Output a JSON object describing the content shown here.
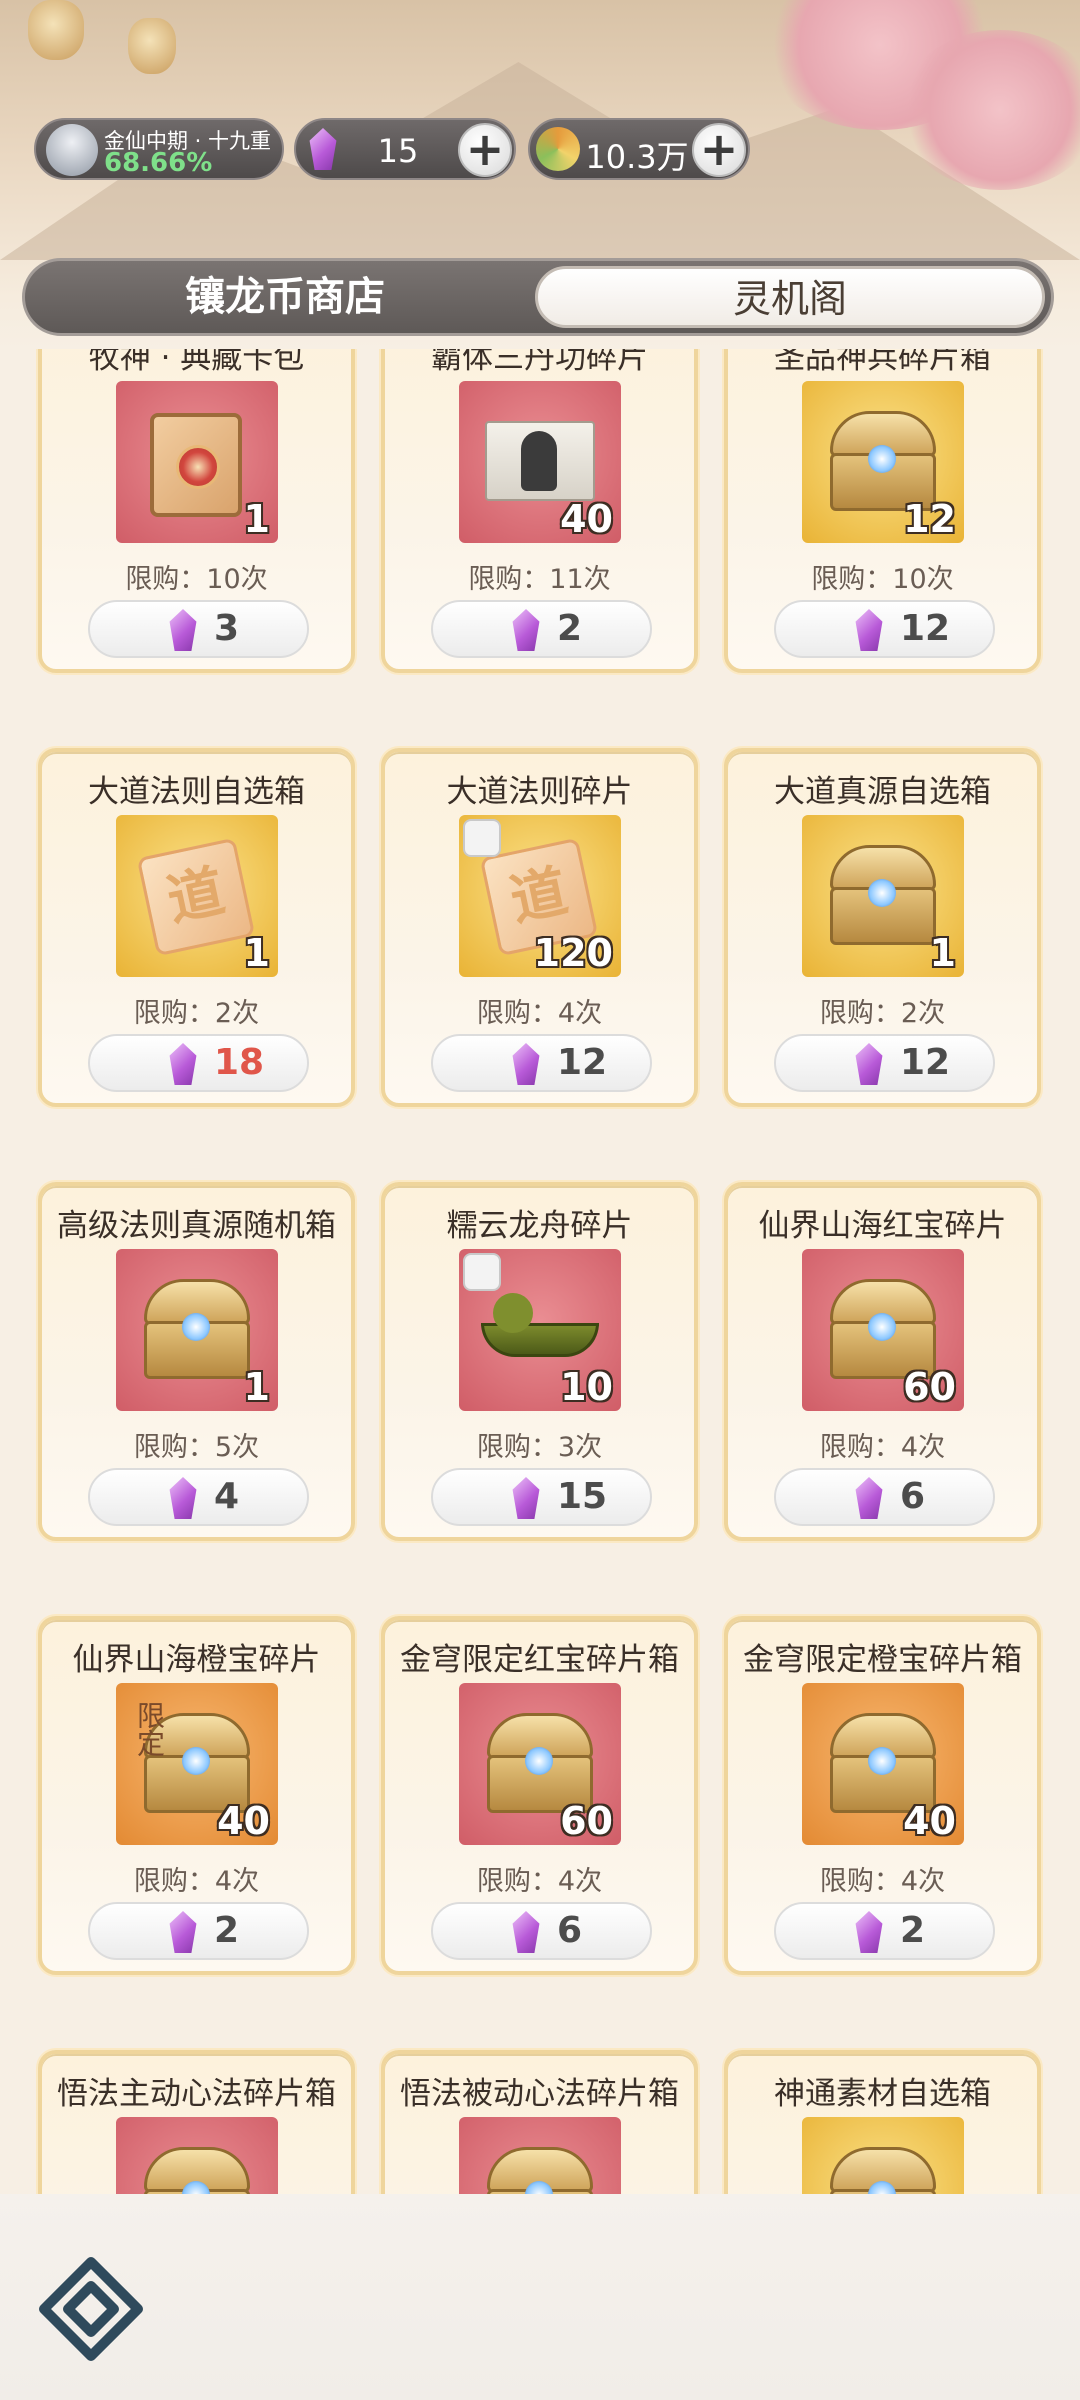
{
  "header": {
    "realm_name": "金仙中期 · 十九重",
    "realm_progress": "68.66%",
    "currency1": {
      "icon": "crystal-icon",
      "value": "15"
    },
    "currency2": {
      "icon": "spirit-swirl-icon",
      "value": "10.3万"
    },
    "plus_label": "+"
  },
  "tabs": [
    {
      "label": "镶龙币商店",
      "selected": false
    },
    {
      "label": "灵机阁",
      "selected": true
    }
  ],
  "items": [
    {
      "title": "牧神 · 典藏卡包",
      "qty": "1",
      "limit": "限购：10次",
      "price": "3",
      "bg": "red",
      "art": "card-pack"
    },
    {
      "title": "霸体三丹功碎片",
      "qty": "40",
      "limit": "限购：11次",
      "price": "2",
      "bg": "red",
      "art": "scroll-fragment"
    },
    {
      "title": "圣品神兵碎片箱",
      "qty": "12",
      "limit": "限购：10次",
      "price": "12",
      "bg": "gold",
      "art": "chest"
    },
    {
      "title": "大道法则自选箱",
      "qty": "1",
      "limit": "限购：2次",
      "price": "18",
      "price_red": true,
      "bg": "gold",
      "art": "tao",
      "tao_char": "道"
    },
    {
      "title": "大道法则碎片",
      "qty": "120",
      "limit": "限购：4次",
      "price": "12",
      "bg": "gold",
      "art": "tao",
      "tao_char": "道",
      "fragment": true
    },
    {
      "title": "大道真源自选箱",
      "qty": "1",
      "limit": "限购：2次",
      "price": "12",
      "bg": "gold",
      "art": "chest"
    },
    {
      "title": "高级法则真源随机箱",
      "qty": "1",
      "limit": "限购：5次",
      "price": "4",
      "bg": "red",
      "art": "chest"
    },
    {
      "title": "糯云龙舟碎片",
      "qty": "10",
      "limit": "限购：3次",
      "price": "15",
      "bg": "red",
      "art": "dragon-boat",
      "fragment": true
    },
    {
      "title": "仙界山海红宝碎片",
      "qty": "60",
      "limit": "限购：4次",
      "price": "6",
      "bg": "red",
      "art": "chest"
    },
    {
      "title": "仙界山海橙宝碎片",
      "qty": "40",
      "limit": "限购：4次",
      "price": "2",
      "bg": "orange",
      "art": "chest",
      "badge": "限定"
    },
    {
      "title": "金穹限定红宝碎片箱",
      "qty": "60",
      "limit": "限购：4次",
      "price": "6",
      "bg": "red",
      "art": "chest"
    },
    {
      "title": "金穹限定橙宝碎片箱",
      "qty": "40",
      "limit": "限购：4次",
      "price": "2",
      "bg": "orange",
      "art": "chest"
    },
    {
      "title": "悟法主动心法碎片箱",
      "qty": "",
      "limit": "",
      "price": "",
      "bg": "red",
      "art": "chest"
    },
    {
      "title": "悟法被动心法碎片箱",
      "qty": "",
      "limit": "",
      "price": "",
      "bg": "red",
      "art": "chest"
    },
    {
      "title": "神通素材自选箱",
      "qty": "",
      "limit": "",
      "price": "",
      "bg": "gold",
      "art": "chest"
    }
  ],
  "bottom": {
    "menu_icon": "menu-diamond-icon"
  }
}
